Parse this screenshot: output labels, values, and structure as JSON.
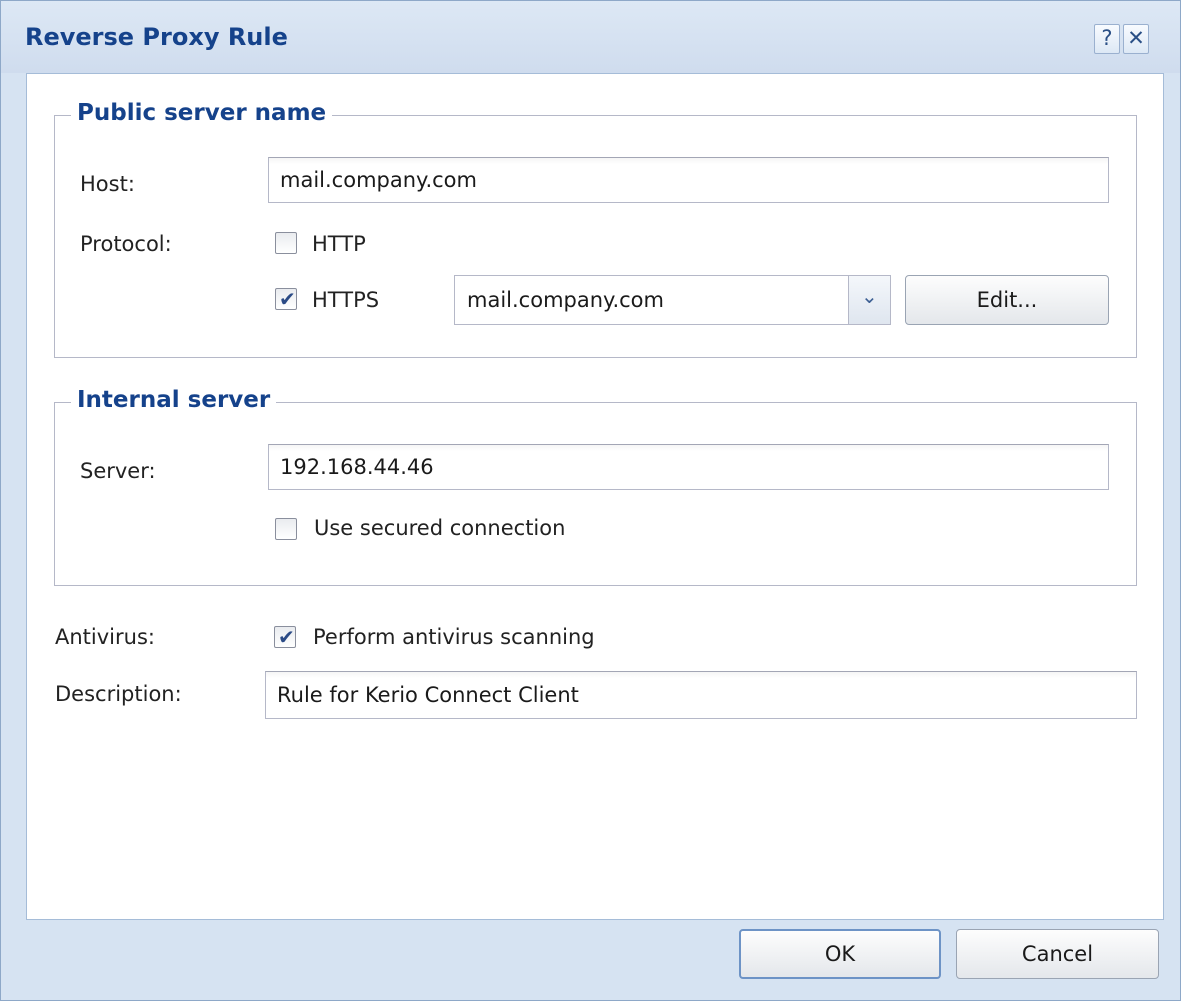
{
  "dialog": {
    "title": "Reverse Proxy Rule",
    "help_label": "?",
    "close_label": "✕"
  },
  "public_server": {
    "legend": "Public server name",
    "host_label": "Host:",
    "host_value": "mail.company.com",
    "protocol_label": "Protocol:",
    "http_label": "HTTP",
    "http_checked": false,
    "https_label": "HTTPS",
    "https_checked": true,
    "certificate_value": "mail.company.com",
    "edit_label": "Edit..."
  },
  "internal_server": {
    "legend": "Internal server",
    "server_label": "Server:",
    "server_value": "192.168.44.46",
    "secured_label": "Use secured connection",
    "secured_checked": false
  },
  "antivirus": {
    "label": "Antivirus:",
    "checkbox_label": "Perform antivirus scanning",
    "checked": true
  },
  "description": {
    "label": "Description:",
    "value": "Rule for Kerio Connect Client"
  },
  "footer": {
    "ok_label": "OK",
    "cancel_label": "Cancel"
  },
  "colors": {
    "title_text": "#15428b",
    "window_frame": "#d6e3f2",
    "checkmark": "#2b4b86"
  },
  "icons": {
    "help": "help-icon",
    "close": "close-icon",
    "dropdown": "chevron-down-icon",
    "check": "checkmark-icon"
  }
}
